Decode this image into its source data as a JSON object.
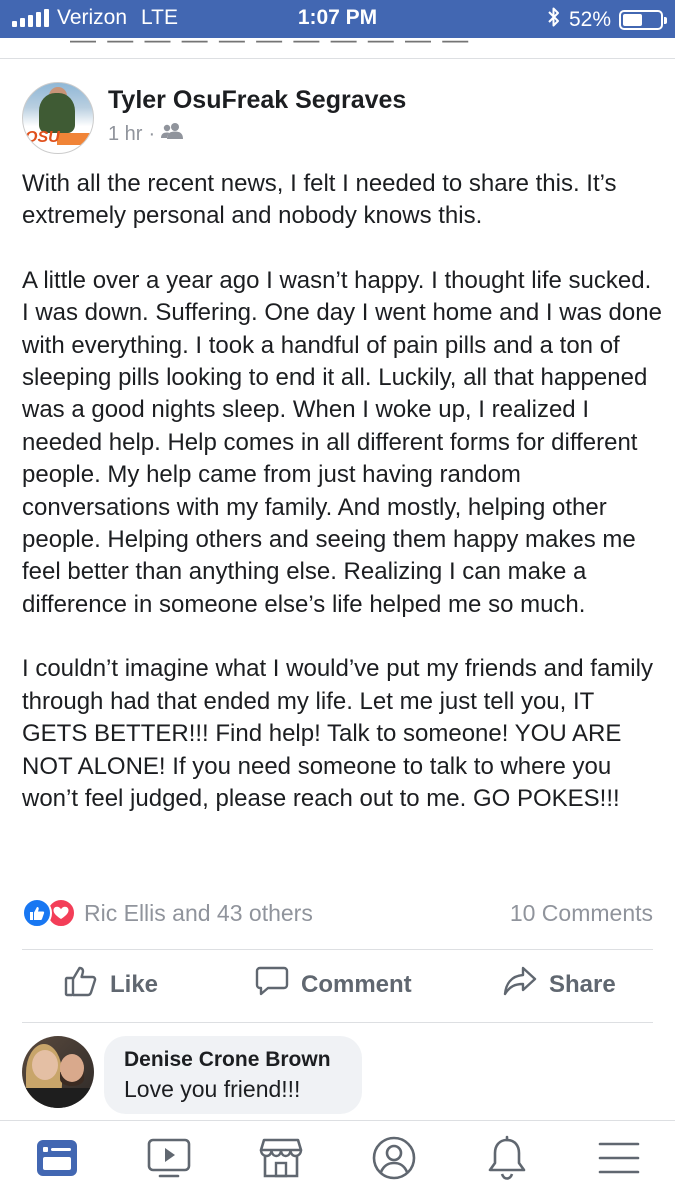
{
  "status_bar": {
    "carrier": "Verizon",
    "network": "LTE",
    "time": "1:07 PM",
    "battery_percent": "52%",
    "battery_level": 0.52,
    "icons": [
      "signal-icon",
      "bluetooth-icon",
      "battery-icon"
    ]
  },
  "post": {
    "author": "Tyler OsuFreak Segraves",
    "time_ago": "1 hr",
    "separator": "·",
    "audience_icon": "friends-icon",
    "paragraphs": [
      "With all the recent news, I felt I needed to share this. It’s extremely personal and nobody knows this.",
      "A little over a year ago I wasn’t happy. I thought life sucked. I was down. Suffering. One day I went home and I was done with everything. I took a handful of pain pills and a ton of sleeping pills looking to end it all. Luckily, all that happened was a good nights sleep. When I woke up, I realized I needed help. Help comes in all different forms for different people. My help came from just having random conversations with my family. And mostly, helping other people. Helping others and seeing them happy makes me feel better than anything else. Realizing I can make a difference in someone else’s life helped me so much.",
      "I couldn’t imagine what I would’ve put my friends and family through had that ended my life. Let me just tell you, IT GETS BETTER!!! Find help! Talk to someone! YOU ARE NOT ALONE! If you need someone to talk to where you won’t feel judged, please reach out to me. GO POKES!!!"
    ],
    "reactions_text": "Ric Ellis and 43 others",
    "comments_count": "10 Comments",
    "actions": {
      "like": "Like",
      "comment": "Comment",
      "share": "Share"
    }
  },
  "comment": {
    "name": "Denise Crone Brown",
    "text": "Love you friend!!!"
  },
  "tabbar": {
    "items": [
      "news-feed-icon",
      "watch-icon",
      "marketplace-icon",
      "profile-icon",
      "notifications-icon",
      "menu-icon"
    ],
    "active": "news-feed-icon"
  },
  "colors": {
    "brand_blue": "#4267b2",
    "like_blue": "#1877f2",
    "love_red": "#f33e58",
    "muted_text": "#90949c",
    "action_text": "#606770"
  }
}
